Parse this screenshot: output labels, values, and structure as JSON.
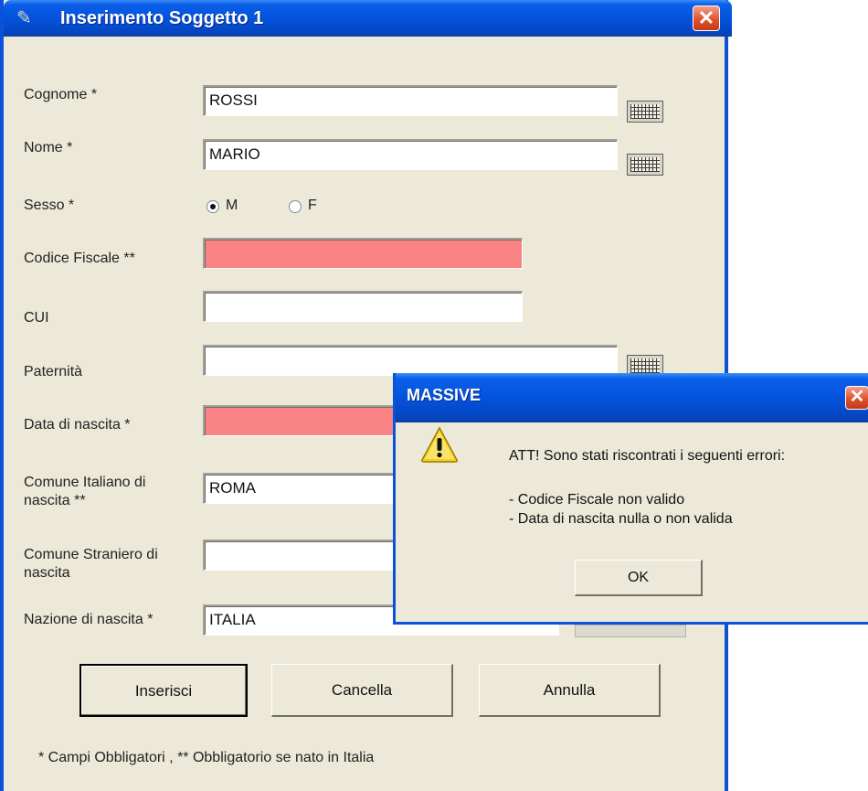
{
  "window": {
    "title": "Inserimento Soggetto 1",
    "close": "✕"
  },
  "form": {
    "cognome": {
      "label": "Cognome *",
      "value": "ROSSI"
    },
    "nome": {
      "label": "Nome *",
      "value": "MARIO"
    },
    "sesso": {
      "label": "Sesso *",
      "option_m": "M",
      "option_f": "F",
      "selected": "M"
    },
    "codice_fiscale": {
      "label": "Codice Fiscale **",
      "value": ""
    },
    "cui": {
      "label": "CUI",
      "value": ""
    },
    "paternita": {
      "label": "Paternità",
      "value": ""
    },
    "data_nascita": {
      "label": "Data di nascita *",
      "value": ""
    },
    "comune_italiano": {
      "label_line1": "Comune Italiano di",
      "label_line2": "nascita **",
      "value": "ROMA"
    },
    "comune_straniero": {
      "label_line1": "Comune Straniero di",
      "label_line2": "nascita",
      "value": ""
    },
    "nazione": {
      "label": "Nazione di nascita *",
      "value": "ITALIA"
    }
  },
  "buttons": {
    "inserisci": "Inserisci",
    "cancella": "Cancella",
    "annulla": "Annulla"
  },
  "footnote": "* Campi Obbligatori , ** Obbligatorio se nato in Italia",
  "dialog": {
    "title": "MASSIVE",
    "close": "✕",
    "message": "ATT! Sono stati riscontrati i seguenti errori:",
    "errors": [
      "- Codice Fiscale non valido",
      "- Data di nascita nulla o non valida"
    ],
    "ok": "OK"
  },
  "colors": {
    "error_field": "#f98284",
    "titlebar": "#0453dd",
    "window_bg": "#ece9d8"
  }
}
